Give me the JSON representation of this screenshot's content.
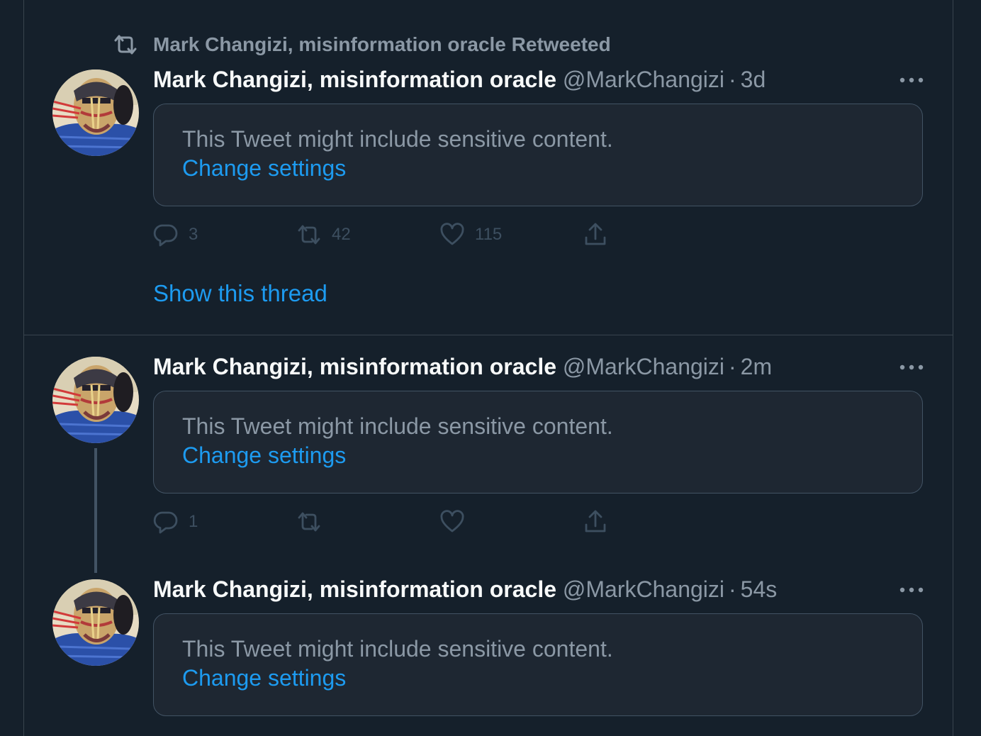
{
  "retweet_label": "Mark Changizi, misinformation oracle Retweeted",
  "tweets": [
    {
      "name": "Mark Changizi, misinformation oracle",
      "handle": "@MarkChangizi",
      "separator": "·",
      "time": "3d",
      "sensitive_text": "This Tweet might include sensitive content.",
      "change_settings": "Change settings",
      "replies": "3",
      "retweets": "42",
      "likes": "115"
    },
    {
      "name": "Mark Changizi, misinformation oracle",
      "handle": "@MarkChangizi",
      "separator": "·",
      "time": "2m",
      "sensitive_text": "This Tweet might include sensitive content.",
      "change_settings": "Change settings",
      "replies": "1",
      "retweets": "",
      "likes": ""
    },
    {
      "name": "Mark Changizi, misinformation oracle",
      "handle": "@MarkChangizi",
      "separator": "·",
      "time": "54s",
      "sensitive_text": "This Tweet might include sensitive content.",
      "change_settings": "Change settings"
    }
  ],
  "show_thread": "Show this thread",
  "colors": {
    "background": "#15202b",
    "accent": "#1d9bf0",
    "secondary_text": "#8b98a5",
    "primary_text": "#f7f9f9",
    "border": "#38444d"
  },
  "icons": {
    "retweet": "retweet-icon",
    "reply": "reply-icon",
    "like": "heart-icon",
    "share": "share-icon",
    "more": "more-icon"
  }
}
